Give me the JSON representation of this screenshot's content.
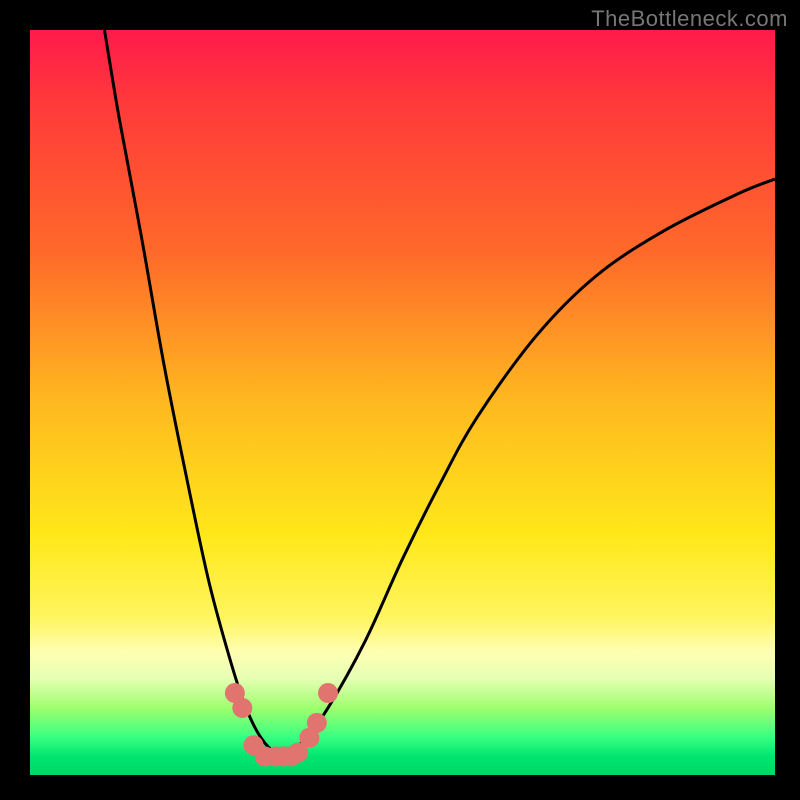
{
  "watermark": "TheBottleneck.com",
  "chart_data": {
    "type": "line",
    "title": "",
    "xlabel": "",
    "ylabel": "",
    "xlim": [
      0,
      100
    ],
    "ylim": [
      0,
      100
    ],
    "series": [
      {
        "name": "bottleneck-curve",
        "x": [
          10,
          12,
          15,
          18,
          21,
          24,
          27,
          29,
          31,
          33,
          35,
          37,
          40,
          45,
          50,
          55,
          60,
          68,
          76,
          85,
          95,
          100
        ],
        "values": [
          100,
          88,
          72,
          55,
          40,
          26,
          15,
          9,
          5,
          3,
          3,
          5,
          9,
          18,
          29,
          39,
          48,
          59,
          67,
          73,
          78,
          80
        ]
      }
    ],
    "markers": {
      "name": "highlight-points",
      "color": "#e2746f",
      "x": [
        27.5,
        28.5,
        30,
        31.5,
        33,
        34,
        35,
        36,
        37.5,
        38.5,
        40
      ],
      "y": [
        11,
        9,
        4,
        2.5,
        2.5,
        2.5,
        2.5,
        3,
        5,
        7,
        11
      ]
    },
    "colors": {
      "curve": "#000000",
      "marker": "#e2746f",
      "top": "#ff1a4b",
      "bottom": "#00d768"
    }
  }
}
